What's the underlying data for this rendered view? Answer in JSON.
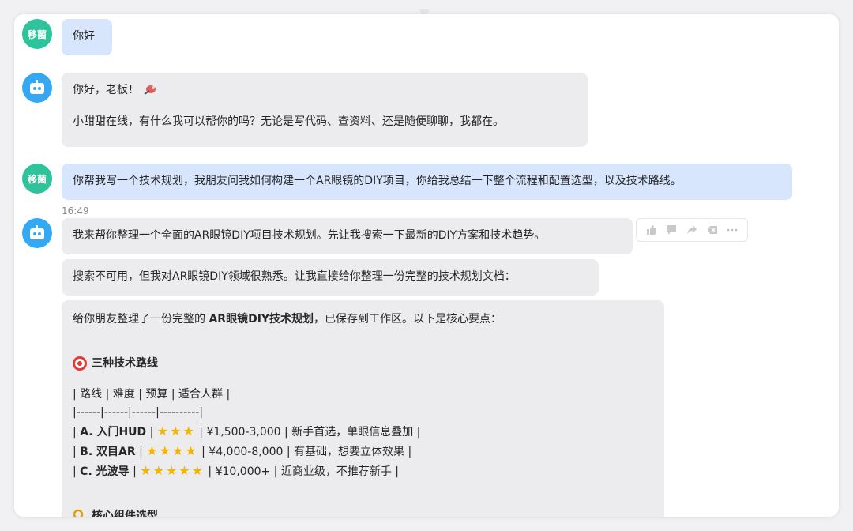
{
  "messages": [
    {
      "role": "user",
      "avatar": "移菌",
      "text": "你好"
    },
    {
      "role": "bot",
      "lines": [
        "你好，老板！",
        "小甜甜在线，有什么我可以帮你的吗？无论是写代码、查资料、还是随便聊聊，我都在。"
      ]
    },
    {
      "role": "user",
      "avatar": "移菌",
      "text": "你帮我写一个技术规划，我朋友问我如何构建一个AR眼镜的DIY项目，你给我总结一下整个流程和配置选型，以及技术路线。"
    },
    {
      "role": "bot",
      "time": "16:49",
      "text": "我来帮你整理一个全面的AR眼镜DIY项目技术规划。先让我搜索一下最新的DIY方案和技术趋势。"
    },
    {
      "role": "bot",
      "text": "搜索不可用，但我对AR眼镜DIY领域很熟悉。让我直接给你整理一份完整的技术规划文档："
    },
    {
      "role": "bot",
      "intro_pre": "给你朋友整理了一份完整的 ",
      "intro_bold": "AR眼镜DIY技术规划",
      "intro_post": "，已保存到工作区。以下是核心要点：",
      "section1": "三种技术路线",
      "table_header": "| 路线 | 难度 | 预算 | 适合人群 |",
      "table_sep": "|------|------|------|----------|",
      "rows": [
        {
          "route": "A. 入门HUD",
          "stars": 3,
          "budget": "¥1,500-3,000",
          "fit": "新手首选，单眼信息叠加"
        },
        {
          "route": "B. 双目AR",
          "stars": 4,
          "budget": "¥4,000-8,000",
          "fit": "有基础，想要立体效果"
        },
        {
          "route": "C. 光波导",
          "stars": 5,
          "budget": "¥10,000+",
          "fit": "近商业级，不推荐新手"
        }
      ],
      "section2": "核心组件选型"
    }
  ],
  "actions": [
    "like-icon",
    "comment-icon",
    "share-icon",
    "delete-icon",
    "more-icon"
  ],
  "colors": {
    "user_bubble": "#d7e5fd",
    "bot_bubble": "#ececee",
    "user_avatar": "#2ec39b",
    "bot_avatar": "#35a8f3"
  }
}
